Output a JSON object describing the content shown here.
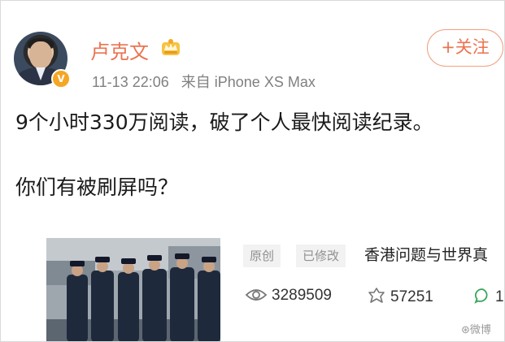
{
  "user": {
    "name": "卢克文",
    "verified_badge": "V",
    "timestamp": "11-13 22:06",
    "source": "来自 iPhone XS Max"
  },
  "follow_button": {
    "label": "+关注"
  },
  "post": {
    "line1": "9个小时330万阅读，破了个人最快阅读纪录。",
    "line2": "你们有被刷屏吗？"
  },
  "article": {
    "tag_original": "原创",
    "tag_edited": "已修改",
    "title": "香港问题与世界真",
    "views": "3289509",
    "shares": "57251",
    "comments": "1"
  },
  "watermark": "⊛微博",
  "colors": {
    "accent": "#eb7350",
    "badge": "#f5a623",
    "muted": "#808080"
  },
  "icons": [
    "avatar",
    "crown-icon",
    "verified-icon",
    "eye-icon",
    "share-icon",
    "comment-icon"
  ]
}
